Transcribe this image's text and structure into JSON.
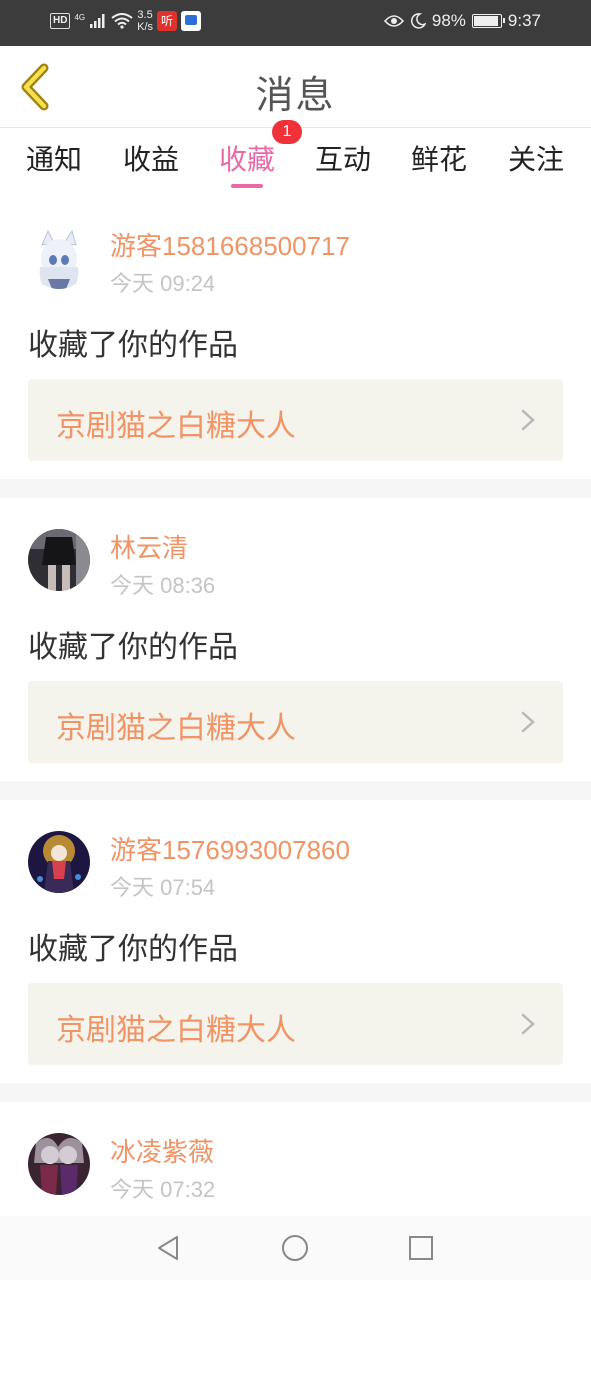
{
  "status_bar": {
    "hd": "HD",
    "network": "4G",
    "speed_value": "3.5",
    "speed_unit": "K/s",
    "app1": "听",
    "battery": "98%",
    "time": "9:37"
  },
  "header": {
    "title": "消息"
  },
  "tabs": [
    {
      "label": "通知"
    },
    {
      "label": "收益"
    },
    {
      "label": "收藏"
    },
    {
      "label": "互动"
    },
    {
      "label": "鲜花"
    },
    {
      "label": "关注"
    }
  ],
  "active_tab": "收藏",
  "badge": "1",
  "items": [
    {
      "user": "游客1581668500717",
      "time": "今天 09:24",
      "action": "收藏了你的作品",
      "work": "京剧猫之白糖大人",
      "avatar_color": "#dfe6f2"
    },
    {
      "user": "林云清",
      "time": "今天 08:36",
      "action": "收藏了你的作品",
      "work": "京剧猫之白糖大人",
      "avatar_color": "#4a4a52"
    },
    {
      "user": "游客1576993007860",
      "time": "今天 07:54",
      "action": "收藏了你的作品",
      "work": "京剧猫之白糖大人",
      "avatar_color": "#2a2450"
    },
    {
      "user": "冰凌紫薇",
      "time": "今天 07:32",
      "action": "",
      "work": "",
      "avatar_color": "#5a3a4a"
    }
  ],
  "colors": {
    "accent_pink": "#e86aa6",
    "username_orange": "#f09466",
    "work_box_bg": "#f4f4ec",
    "badge_red": "#f0313a"
  },
  "icons": {
    "back": "chevron-left-icon",
    "nav_back": "triangle-back-icon",
    "nav_home": "circle-home-icon",
    "nav_recent": "square-recent-icon"
  }
}
